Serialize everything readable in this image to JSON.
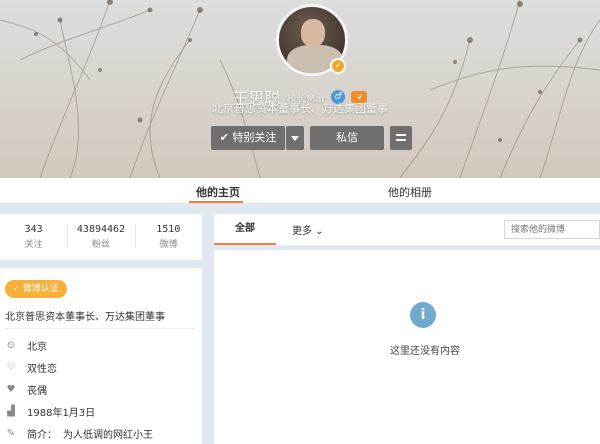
{
  "profile": {
    "name": "王思聪",
    "nickname": "校长Mar",
    "bio": "北京普思资本董事长、万达集团董事",
    "verify_mark": "✓",
    "male_mark": "♂",
    "vip_mark": "v"
  },
  "buttons": {
    "follow": "特别关注",
    "message": "私信"
  },
  "tabs": {
    "home": "他的主页",
    "album": "他的相册"
  },
  "stats": [
    {
      "num": "343",
      "label": "关注"
    },
    {
      "num": "43894462",
      "label": "粉丝"
    },
    {
      "num": "1510",
      "label": "微博"
    }
  ],
  "info": {
    "verified_label": "微博认证",
    "company": "北京普思资本董事长、万达集团董事",
    "location": "北京",
    "orientation": "双性恋",
    "relationship": "丧偶",
    "birthday": "1988年1月3日",
    "intro_label": "简介：",
    "intro": "为人低调的网红小王"
  },
  "main": {
    "tab_all": "全部",
    "tab_more": "更多 ⌄",
    "search_placeholder": "搜索他的微博",
    "empty_icon": "i",
    "empty_text": "这里还没有内容"
  },
  "colors": {
    "accent": "#f77c3d",
    "button_gray": "#6f6f6f",
    "verified_yellow": "#f8b038",
    "info_blue": "#74a9cf"
  }
}
